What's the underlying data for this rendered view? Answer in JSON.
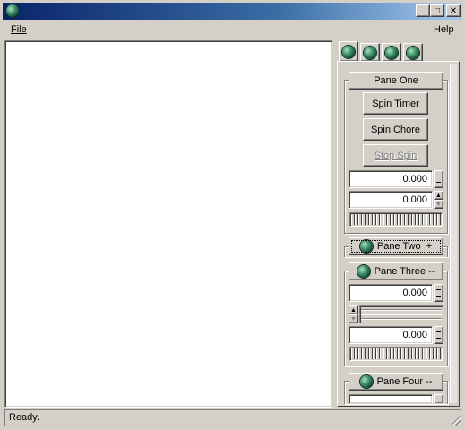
{
  "window": {
    "title": "",
    "controls": {
      "minimize": "_",
      "maximize": "□",
      "close": "✕"
    }
  },
  "menu": {
    "file": "File",
    "help": "Help"
  },
  "tabs": [
    {
      "icon": "gem-icon"
    },
    {
      "icon": "gem-icon"
    },
    {
      "icon": "gem-icon"
    },
    {
      "icon": "gem-icon"
    }
  ],
  "pane_one": {
    "header": "Pane One",
    "spin_timer": "Spin Timer",
    "spin_chore": "Spin Chore",
    "stop_spin": "Stop Spin",
    "value1": "0.000",
    "value2": "0.000"
  },
  "pane_two": {
    "header": "Pane Two  +"
  },
  "pane_three": {
    "header": "Pane Three --",
    "value1": "0.000",
    "value2": "0.000"
  },
  "pane_four": {
    "header": "Pane Four --"
  },
  "status": {
    "text": "Ready."
  }
}
